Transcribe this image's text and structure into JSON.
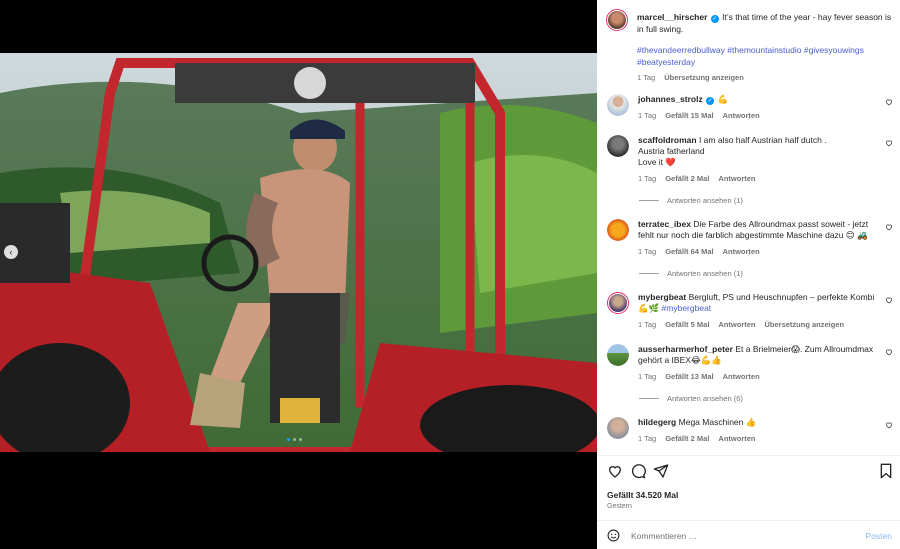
{
  "post": {
    "author": "marcel__hirscher",
    "caption": "It’s that time of the year - hay fever season is in full swing.",
    "hashtags": [
      "#thevandeerredbullway",
      "#themountainstudio",
      "#givesyouwings",
      "#beatyesterday"
    ],
    "time": "1 Tag",
    "translate": "Übersetzung anzeigen"
  },
  "comments": [
    {
      "user": "johannes_strolz",
      "verified": true,
      "text": "💪",
      "time": "1 Tag",
      "likes": "Gefällt 15 Mal",
      "reply": "Antworten",
      "extra": "",
      "view_replies": ""
    },
    {
      "user": "scaffoldroman",
      "verified": false,
      "text": "I am also half Austrian half dutch .",
      "text2": "Austria fatherland",
      "text3": "Love it ❤️",
      "time": "1 Tag",
      "likes": "Gefällt 2 Mal",
      "reply": "Antworten",
      "extra": "",
      "view_replies": "Antworten ansehen (1)"
    },
    {
      "user": "terratec_ibex",
      "verified": false,
      "text": "Die Farbe des Allroundmax passt soweit - jetzt fehlt nur noch die farblich abgestimmte Maschine dazu 😊 🚜",
      "time": "1 Tag",
      "likes": "Gefällt 64 Mal",
      "reply": "Antworten",
      "extra": "",
      "view_replies": "Antworten ansehen (1)"
    },
    {
      "user": "mybergbeat",
      "verified": false,
      "text": "Bergluft, PS und Heuschnupfen – perfekte Kombi 💪🌿",
      "tag": "#mybergbeat",
      "time": "1 Tag",
      "likes": "Gefällt 5 Mal",
      "reply": "Antworten",
      "extra": "Übersetzung anzeigen",
      "view_replies": ""
    },
    {
      "user": "ausserharmerhof_peter",
      "verified": false,
      "text": "Et a Brielmeier😱. Zum Allroumdmax gehört a IBEX😂💪👍",
      "time": "1 Tag",
      "likes": "Gefällt 13 Mal",
      "reply": "Antworten",
      "extra": "",
      "view_replies": "Antworten ansehen (6)"
    },
    {
      "user": "hildegerg",
      "verified": false,
      "text": "Mega Maschinen 👍",
      "time": "1 Tag",
      "likes": "Gefällt 2 Mal",
      "reply": "Antworten",
      "extra": "",
      "view_replies": ""
    }
  ],
  "footer": {
    "likes": "Gefällt 34.520 Mal",
    "date": "Gestern",
    "comment_placeholder": "Kommentieren …",
    "post_label": "Posten"
  },
  "icons": {
    "like": "heart-icon",
    "comment": "comment-icon",
    "share": "share-icon",
    "save": "bookmark-icon",
    "emoji": "emoji-icon"
  },
  "colors": {
    "link": "#4a5ecf",
    "verified": "#0095f6",
    "post_button": "#88b8ec"
  }
}
